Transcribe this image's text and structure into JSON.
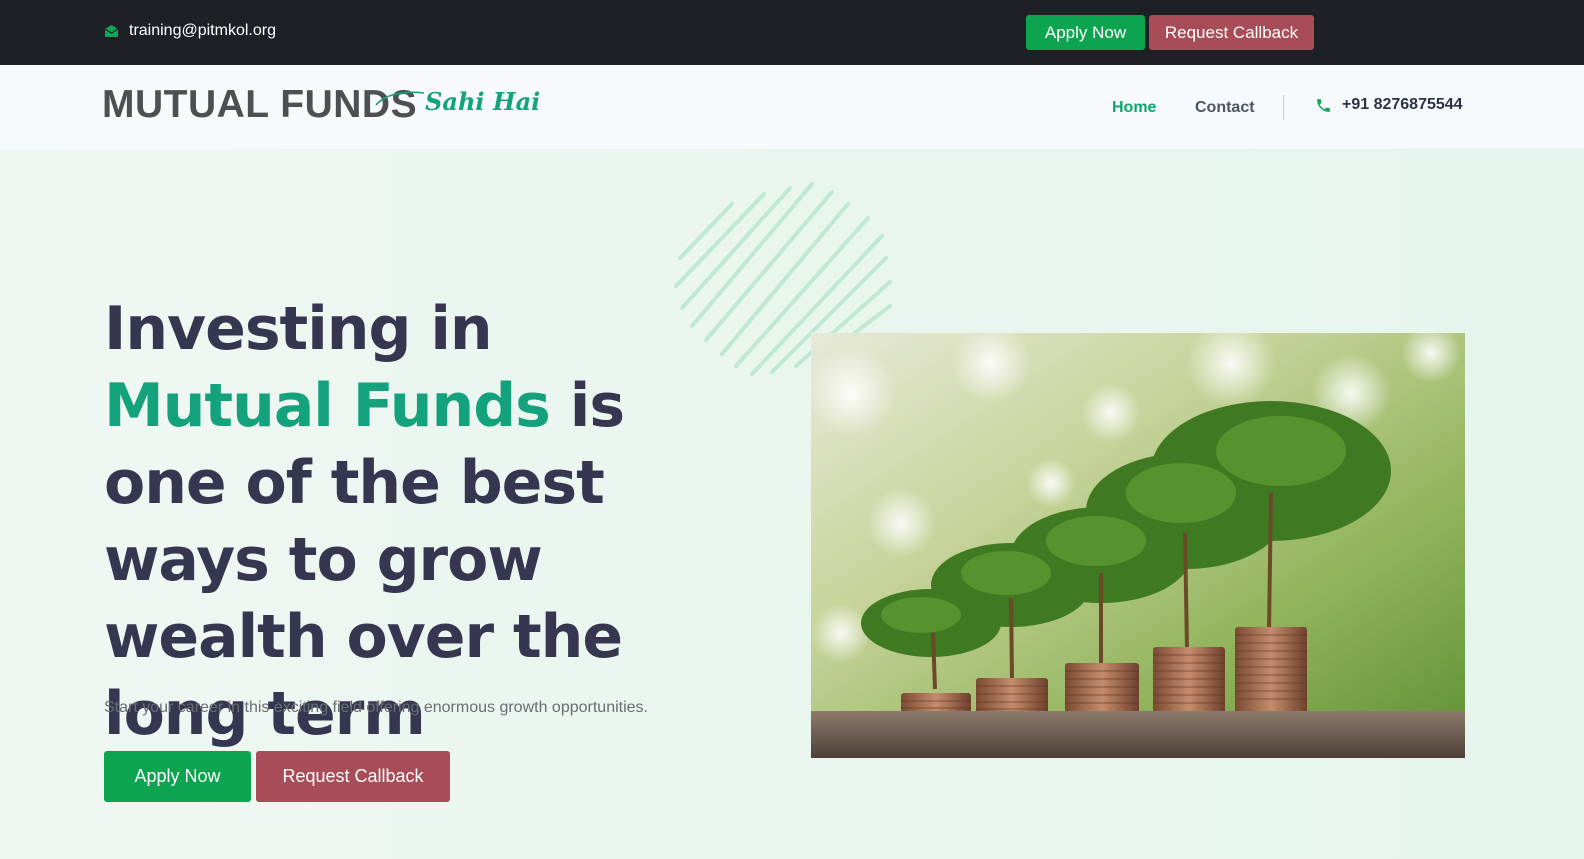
{
  "topbar": {
    "email": "training@pitmkol.org",
    "email_icon": "envelope-icon",
    "apply_label": "Apply Now",
    "callback_label": "Request Callback"
  },
  "navbar": {
    "logo_main": "MUTUAL FUNDS",
    "logo_script": "Sahi Hai",
    "links": [
      {
        "label": "Home",
        "active": true
      },
      {
        "label": "Contact",
        "active": false
      }
    ],
    "phone_icon": "phone-icon",
    "phone": "+91 8276875544"
  },
  "hero": {
    "headline_part1": "Investing in ",
    "headline_accent": "Mutual Funds",
    "headline_part2": " is one of the best ways to grow wealth over the long term",
    "subtitle": "Start your career in this exciting field offering enormous growth opportunities.",
    "apply_label": "Apply Now",
    "callback_label": "Request Callback",
    "image_subject": "trees-growing-on-coin-stacks"
  },
  "colors": {
    "accent_green": "#0ca44f",
    "accent_teal": "#13a27c",
    "callback_red": "#a84c57",
    "dark_bar": "#1d2126",
    "headline_text": "#373650"
  }
}
